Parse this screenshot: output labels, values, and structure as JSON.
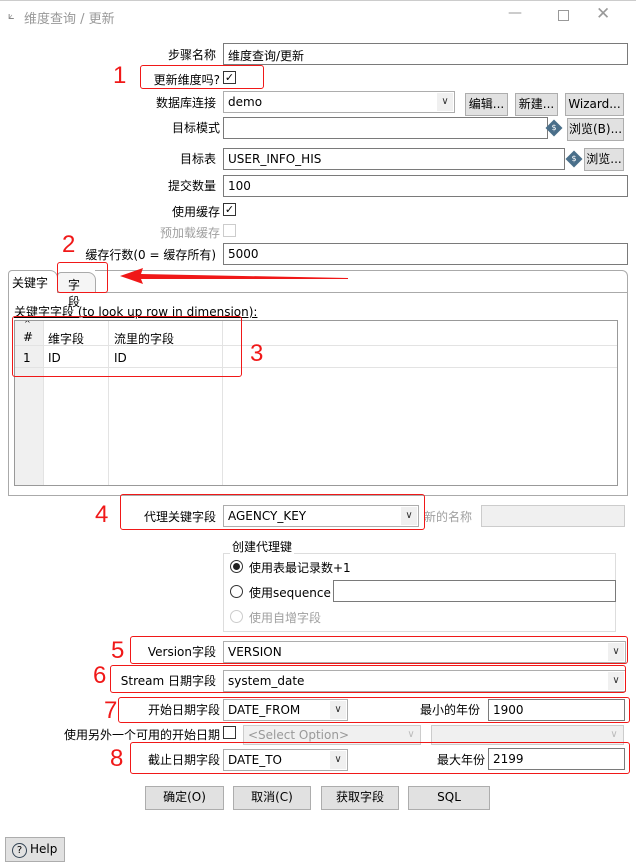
{
  "window": {
    "title": "维度查询 / 更新"
  },
  "form": {
    "step_name_label": "步骤名称",
    "step_name": "维度查询/更新",
    "update_dim_label": "更新维度吗?",
    "update_dim": true,
    "db_conn_label": "数据库连接",
    "db_conn": "demo",
    "edit_btn": "编辑...",
    "new_btn": "新建...",
    "wizard_btn": "Wizard...",
    "schema_label": "目标模式",
    "schema": "",
    "browse_b_btn": "浏览(B)...",
    "table_label": "目标表",
    "table": "USER_INFO_HIS",
    "browse_btn": "浏览...",
    "commit_label": "提交数量",
    "commit": "100",
    "use_cache_label": "使用缓存",
    "use_cache": true,
    "preload_label": "预加载缓存",
    "preload": false,
    "cache_rows_label": "缓存行数(0 = 缓存所有)",
    "cache_rows": "5000"
  },
  "tabs": [
    {
      "label": "关键字"
    },
    {
      "label": "字段"
    }
  ],
  "keys": {
    "caption": "关键字字段 (to look up row in dimension):",
    "columns": [
      "#",
      "维字段",
      "流里的字段"
    ],
    "rows": [
      [
        "1",
        "ID",
        "ID"
      ]
    ]
  },
  "surrogate": {
    "label": "代理关键字段",
    "value": "AGENCY_KEY",
    "new_name_label": "新的名称",
    "new_name": "",
    "group_title": "创建代理键",
    "opt1": "使用表最记录数+1",
    "opt2": "使用sequence",
    "opt3": "使用自增字段",
    "selected": "opt1",
    "sequence": ""
  },
  "version": {
    "label": "Version字段",
    "value": "VERSION"
  },
  "stream_date": {
    "label": "Stream 日期字段",
    "value": "system_date"
  },
  "date_from": {
    "label": "开始日期字段",
    "value": "DATE_FROM",
    "min_year_label": "最小的年份",
    "min_year": "1900"
  },
  "alt_start": {
    "label": "使用另外一个可用的开始日期",
    "checked": false,
    "option": "<Select Option>",
    "option2": ""
  },
  "date_to": {
    "label": "截止日期字段",
    "value": "DATE_TO",
    "max_year_label": "最大年份",
    "max_year": "2199"
  },
  "buttons": {
    "ok": "确定(O)",
    "cancel": "取消(C)",
    "get_fields": "获取字段",
    "sql": "SQL",
    "help": "Help"
  },
  "annotations": [
    "1",
    "2",
    "3",
    "4",
    "5",
    "6",
    "7",
    "8"
  ],
  "colors": {
    "annotation": "#f01818",
    "button": "#e1e1e1"
  }
}
